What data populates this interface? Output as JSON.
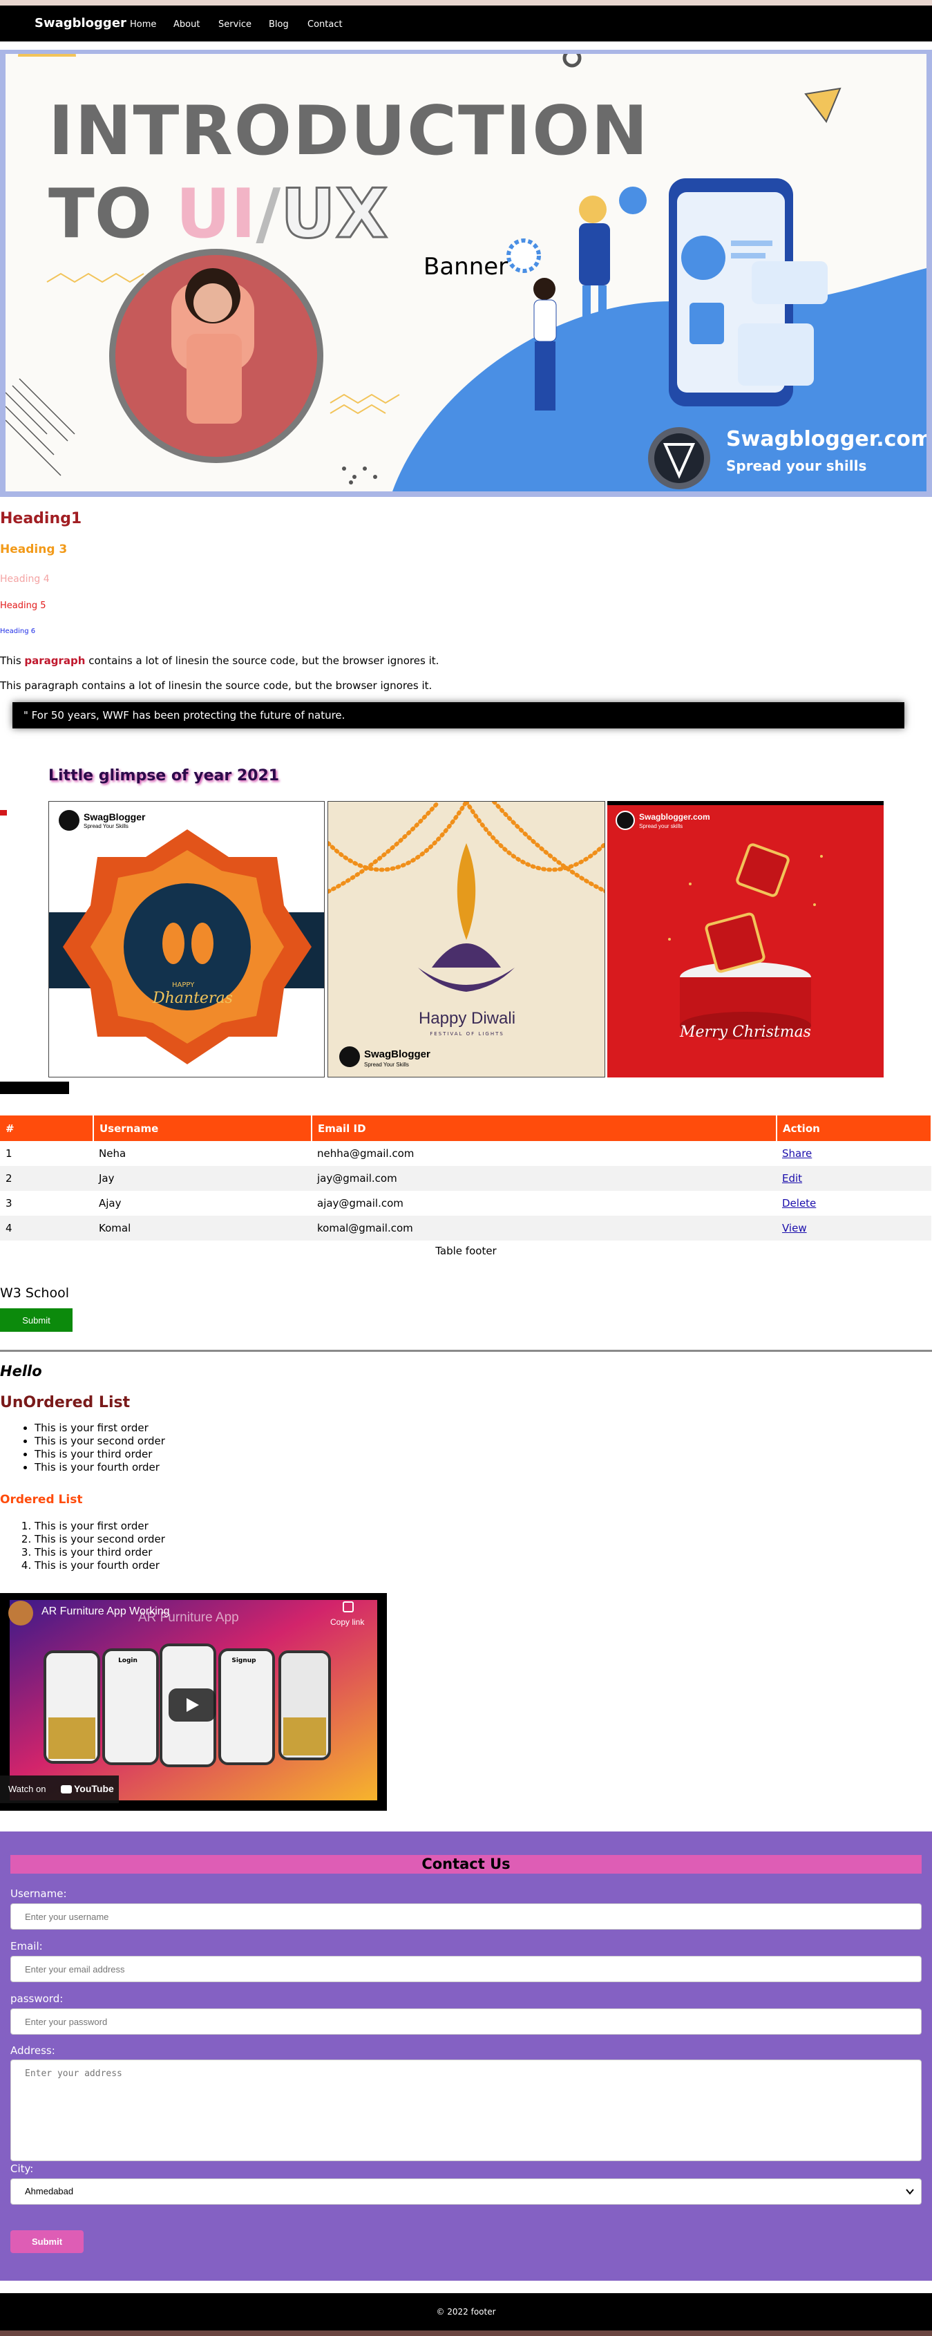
{
  "nav": {
    "brand": "Swagblogger",
    "links": [
      "Home",
      "About",
      "Service",
      "Blog",
      "Contact"
    ]
  },
  "banner": {
    "line1": "INTRODUCTION",
    "line2": "TO",
    "word_ui": "UI",
    "word_ux": "UX",
    "caption": "Banner",
    "site": "Swagblogger.com",
    "tagline": "Spread your shills"
  },
  "headings": {
    "h1": "Heading1",
    "h3": "Heading 3",
    "h4": "Heading 4",
    "h5": "Heading 5",
    "h6": "Heading 6"
  },
  "paragraphs": {
    "p1_before": "This ",
    "p1_highlight": "paragraph",
    "p1_after": " contains a lot of linesin the source code, but the browser ignores it.",
    "p2": "This paragraph contains a lot of linesin the source code, but the browser ignores it."
  },
  "quote": "\" For 50 years, WWF has been protecting the future of nature.",
  "gallery": {
    "title": "Little glimpse of year 2021",
    "items": [
      {
        "brand": "SwagBlogger",
        "sub": "Spread Your Skills",
        "happy": "HAPPY",
        "name": "Dhanteras"
      },
      {
        "name": "Happy Diwali",
        "sub": "FESTIVAL OF LIGHTS",
        "brand": "SwagBlogger",
        "brand_sub": "Spread Your Skills"
      },
      {
        "brand": "Swagblogger.com",
        "sub": "Spread your skills",
        "name": "Merry Christmas"
      }
    ]
  },
  "table": {
    "headers": [
      "#",
      "Username",
      "Email ID",
      "Action"
    ],
    "rows": [
      {
        "num": "1",
        "user": "Neha",
        "email": "nehha@gmail.com",
        "action": "Share"
      },
      {
        "num": "2",
        "user": "Jay",
        "email": "jay@gmail.com",
        "action": "Edit"
      },
      {
        "num": "3",
        "user": "Ajay",
        "email": "ajay@gmail.com",
        "action": "Delete"
      },
      {
        "num": "4",
        "user": "Komal",
        "email": "komal@gmail.com",
        "action": "View"
      }
    ],
    "footer": "Table footer"
  },
  "w3": {
    "label": "W3 School",
    "button": "Submit"
  },
  "hello": "Hello",
  "unordered": {
    "title": "UnOrdered List",
    "items": [
      "This is your first order",
      "This is your second order",
      "This is your third order",
      "This is your fourth order"
    ]
  },
  "ordered": {
    "title": "Ordered List",
    "items": [
      "This is your first order",
      "This is your second order",
      "This is your third order",
      "This is your fourth order"
    ]
  },
  "video": {
    "title": "AR Furniture App Working",
    "watermark": "AR Furniture App",
    "copy_link": "Copy link",
    "watch_on": "Watch on",
    "youtube": "YouTube",
    "phone_labels": [
      "Login",
      "Signup"
    ]
  },
  "contact": {
    "title": "Contact Us",
    "username_label": "Username:",
    "username_placeholder": "Enter your username",
    "email_label": "Email:",
    "email_placeholder": "Enter your email address",
    "password_label": "password:",
    "password_placeholder": "Enter your password",
    "address_label": "Address:",
    "address_placeholder": "Enter your address",
    "city_label": "City:",
    "city_value": "Ahmedabad",
    "submit": "Submit"
  },
  "footer": "© 2022 footer",
  "colors": {
    "table_header": "#ff4c0c",
    "contact_bg": "#8461c3",
    "contact_accent": "#de5db5",
    "submit_green": "#0c8a0c"
  }
}
